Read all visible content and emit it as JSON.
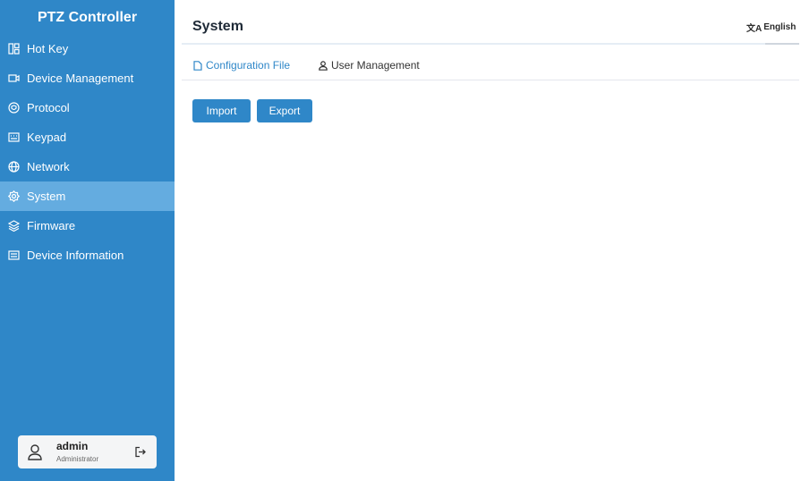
{
  "sidebar": {
    "app_title": "PTZ Controller",
    "items": [
      {
        "label": "Hot Key",
        "icon": "hotkey-icon"
      },
      {
        "label": "Device Management",
        "icon": "camera-icon"
      },
      {
        "label": "Protocol",
        "icon": "shield-icon"
      },
      {
        "label": "Keypad",
        "icon": "keyboard-icon"
      },
      {
        "label": "Network",
        "icon": "globe-icon"
      },
      {
        "label": "System",
        "icon": "gear-icon",
        "active": true
      },
      {
        "label": "Firmware",
        "icon": "layers-icon"
      },
      {
        "label": "Device Information",
        "icon": "info-card-icon"
      }
    ]
  },
  "user": {
    "name": "admin",
    "role": "Administrator"
  },
  "header": {
    "title": "System",
    "language": "English"
  },
  "tabs": {
    "config": "Configuration File",
    "user_mgmt": "User Management",
    "active": "Configuration File"
  },
  "actions": {
    "import_label": "Import",
    "export_label": "Export"
  },
  "colors": {
    "sidebar": "#2f87c8",
    "active_item": "#64ace0",
    "accent": "#2f87c8"
  }
}
